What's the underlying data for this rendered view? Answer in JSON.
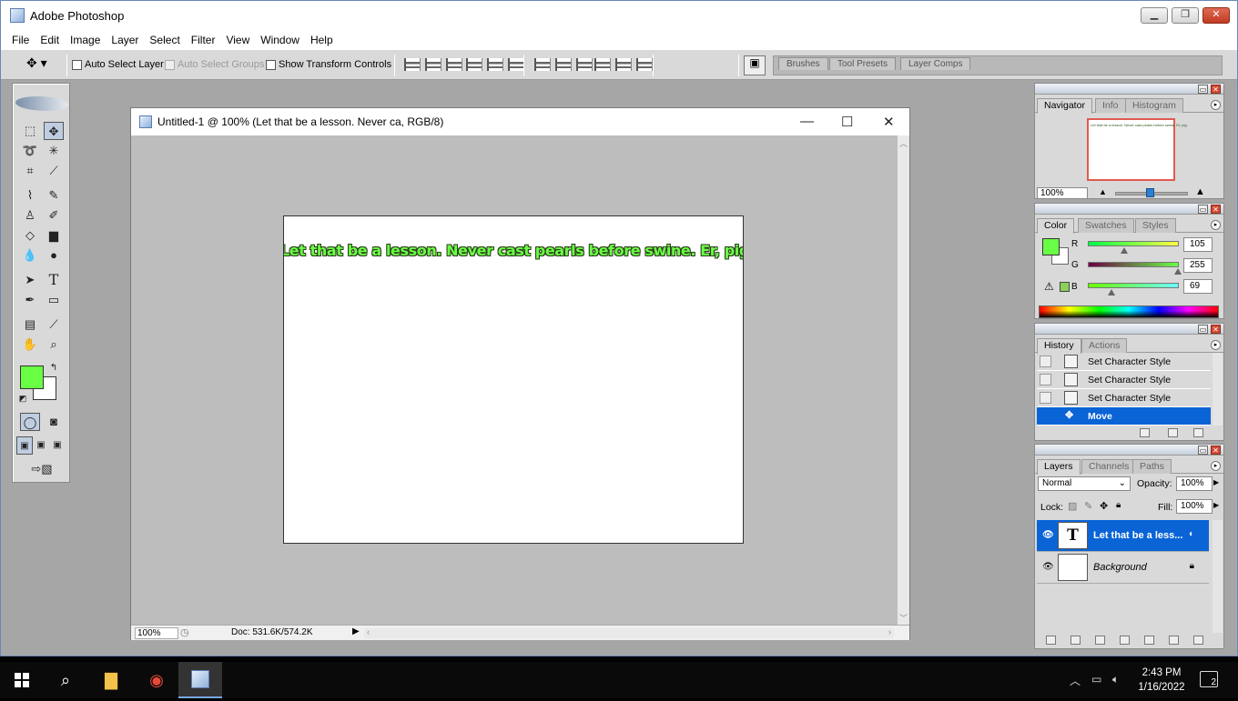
{
  "app": {
    "title": "Adobe Photoshop"
  },
  "menu": [
    "File",
    "Edit",
    "Image",
    "Layer",
    "Select",
    "Filter",
    "View",
    "Window",
    "Help"
  ],
  "options": {
    "auto_select_layer": "Auto Select Layer",
    "auto_select_groups": "Auto Select Groups",
    "show_transform_controls": "Show Transform Controls"
  },
  "palette_well": {
    "tabs": [
      "Brushes",
      "Tool Presets",
      "Layer Comps"
    ]
  },
  "document": {
    "title": "Untitled-1 @ 100% (Let that be a lesson. Never ca, RGB/8)",
    "canvas_text": "Let that be a lesson. Never cast pearls before swine. Er, pig.",
    "zoom": "100%",
    "doc_size": "Doc: 531.6K/574.2K"
  },
  "navigator": {
    "tabs": [
      "Navigator",
      "Info",
      "Histogram"
    ],
    "zoom": "100%",
    "thumb_text": "Let that be a lesson. Never cast pearls before swine. Er, pig."
  },
  "color": {
    "tabs": [
      "Color",
      "Swatches",
      "Styles"
    ],
    "r_label": "R",
    "g_label": "G",
    "b_label": "B",
    "r": "105",
    "g": "255",
    "b": "69",
    "foreground": "#69ff45",
    "background": "#ffffff"
  },
  "history": {
    "tabs": [
      "History",
      "Actions"
    ],
    "items": [
      "Set Character Style",
      "Set Character Style",
      "Set Character Style",
      "Move"
    ]
  },
  "layers": {
    "tabs": [
      "Layers",
      "Channels",
      "Paths"
    ],
    "blend_mode": "Normal",
    "opacity_label": "Opacity:",
    "opacity": "100%",
    "lock_label": "Lock:",
    "fill_label": "Fill:",
    "fill": "100%",
    "items": [
      {
        "name": "Let that be a less...",
        "thumb": "T"
      },
      {
        "name": "Background",
        "thumb": ""
      }
    ]
  },
  "taskbar": {
    "time": "2:43 PM",
    "date": "1/16/2022",
    "notifications": "2"
  }
}
